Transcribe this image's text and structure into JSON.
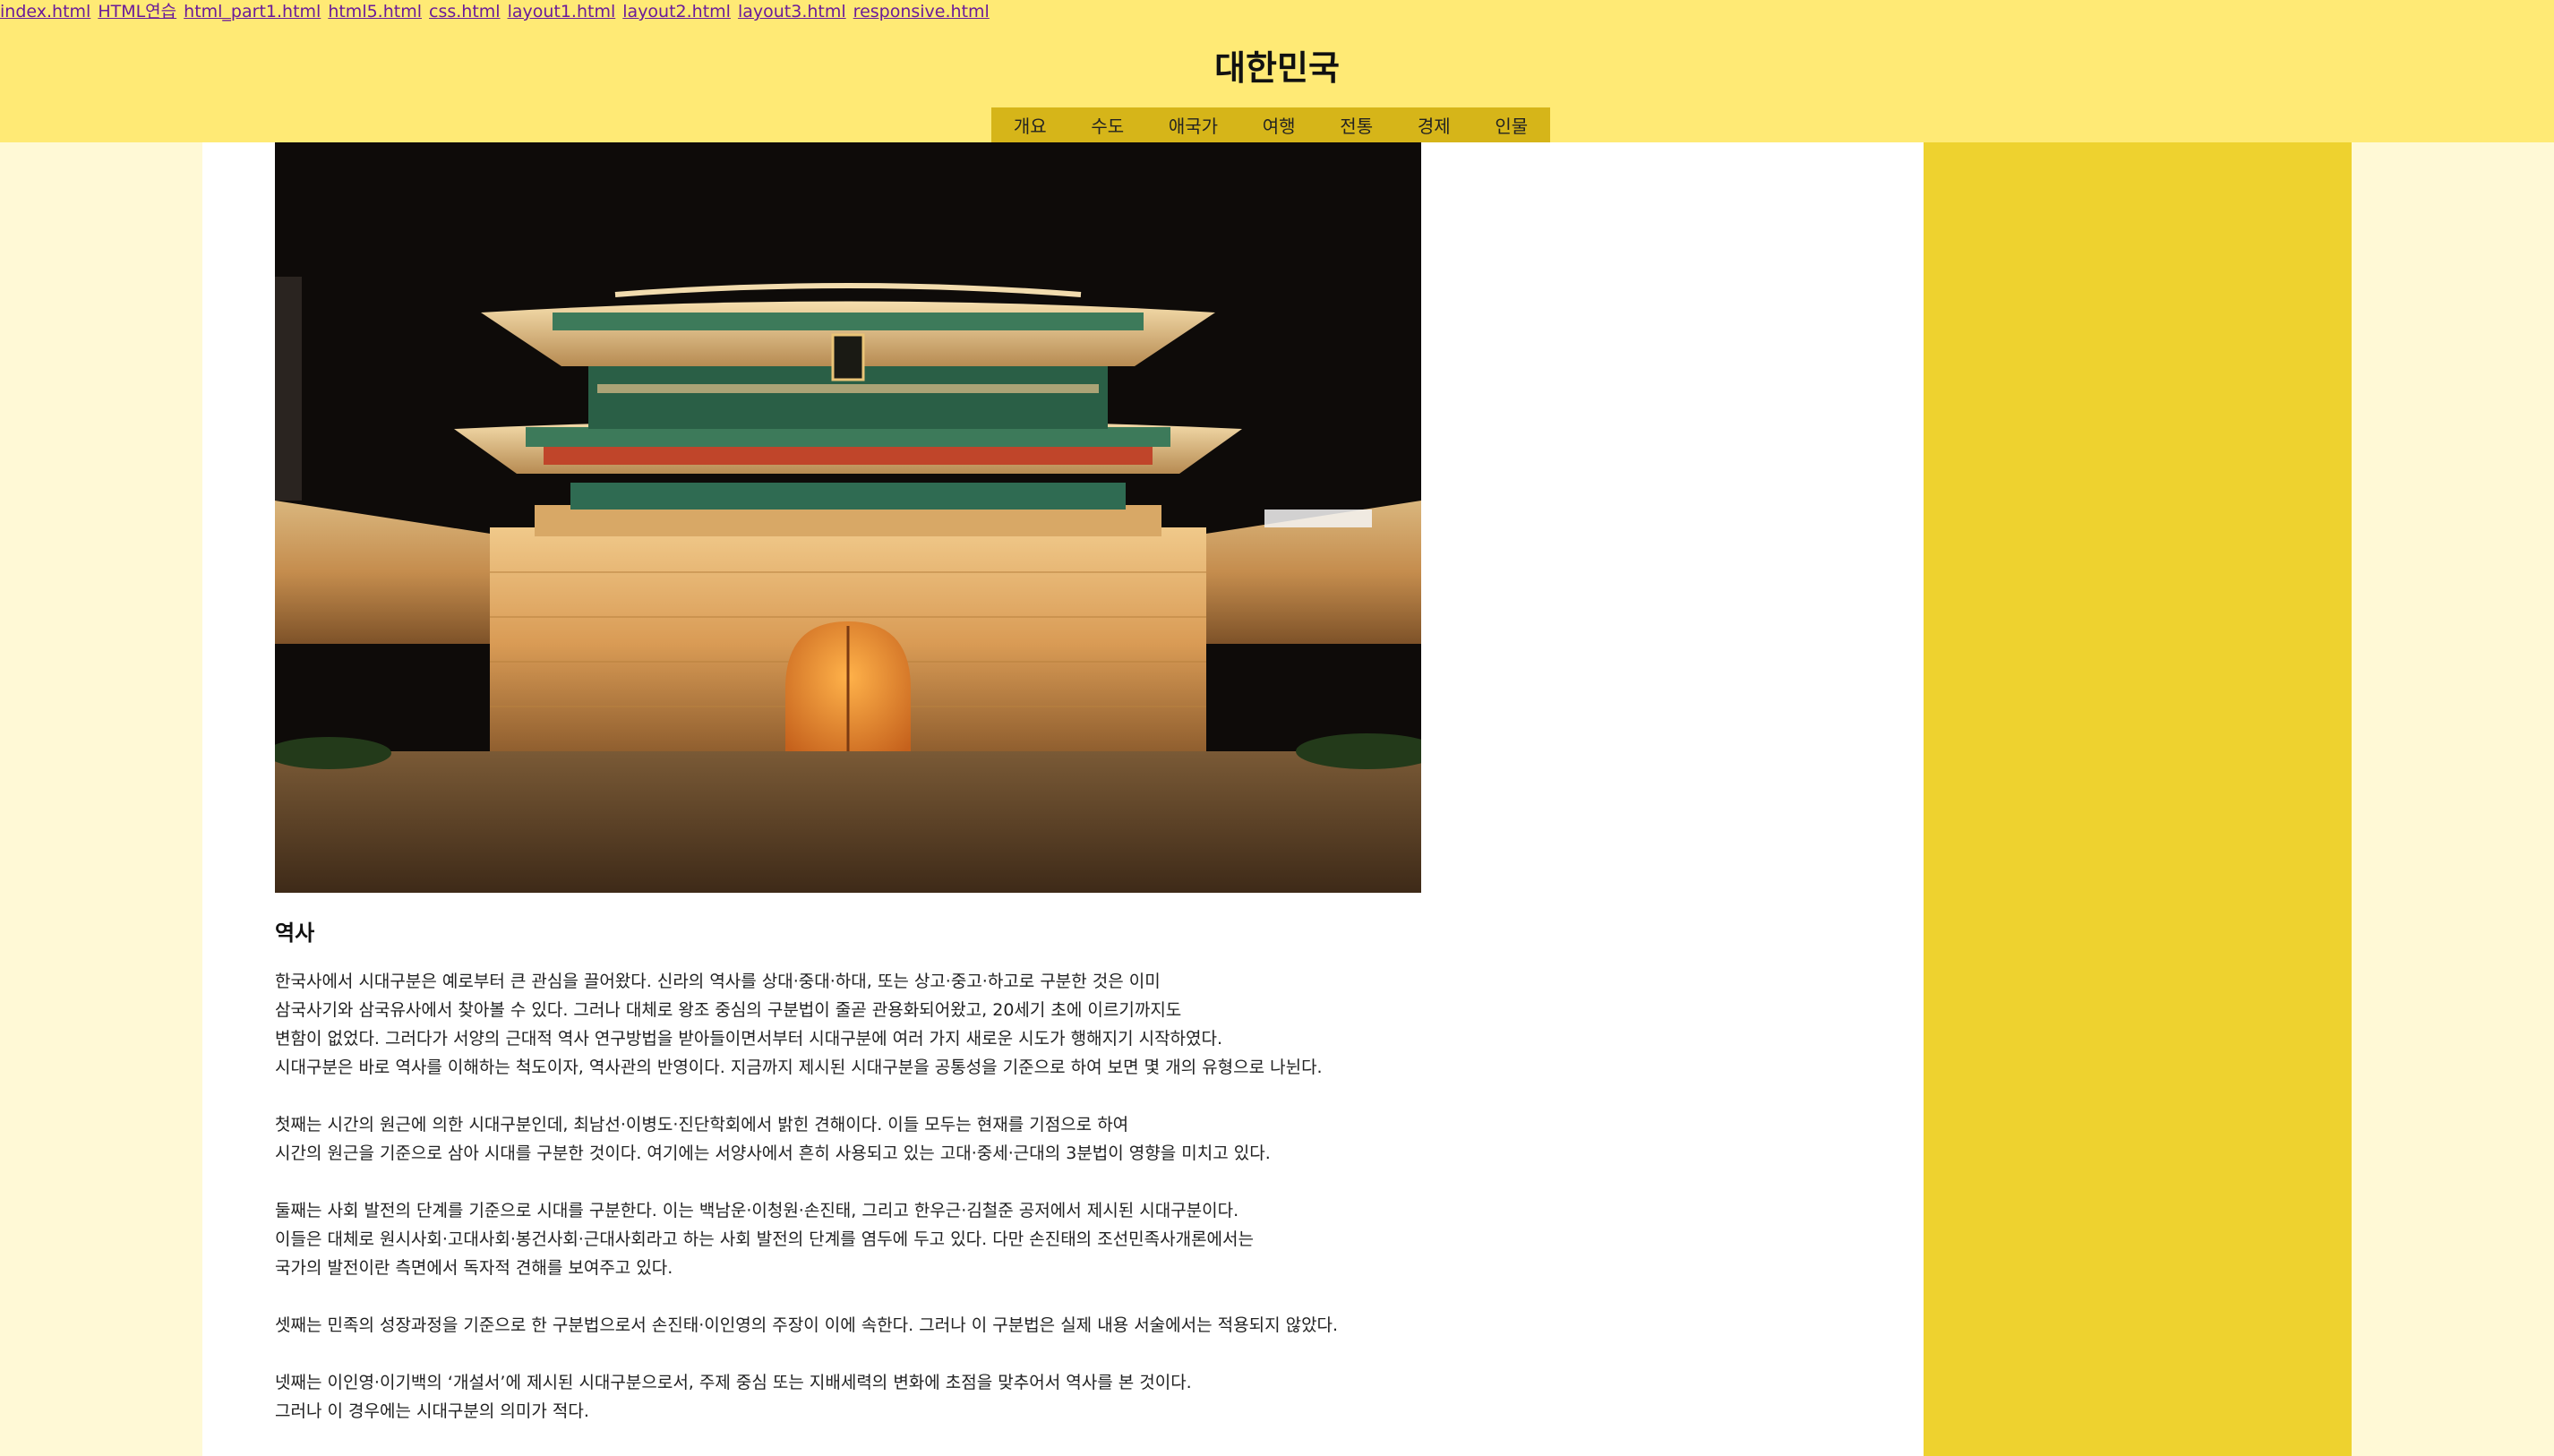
{
  "links": [
    "index.html",
    "HTML연습",
    "html_part1.html",
    "html5.html",
    "css.html",
    "layout1.html",
    "layout2.html",
    "layout3.html",
    "responsive.html"
  ],
  "header": {
    "title": "대한민국"
  },
  "nav": [
    "개요",
    "수도",
    "애국가",
    "여행",
    "전통",
    "경제",
    "인물"
  ],
  "main": {
    "section_title": "역사",
    "paragraphs": [
      [
        "한국사에서 시대구분은 예로부터 큰 관심을 끌어왔다. 신라의 역사를 상대·중대·하대, 또는 상고·중고·하고로 구분한 것은 이미",
        "삼국사기와 삼국유사에서 찾아볼 수 있다. 그러나 대체로 왕조 중심의 구분법이 줄곧 관용화되어왔고, 20세기 초에 이르기까지도",
        "변함이 없었다. 그러다가 서양의 근대적 역사 연구방법을 받아들이면서부터 시대구분에 여러 가지 새로운 시도가 행해지기 시작하였다.",
        "시대구분은 바로 역사를 이해하는 척도이자, 역사관의 반영이다. 지금까지 제시된 시대구분을 공통성을 기준으로 하여 보면 몇 개의 유형으로 나뉜다."
      ],
      [
        "첫째는 시간의 원근에 의한 시대구분인데, 최남선·이병도·진단학회에서 밝힌 견해이다. 이들 모두는 현재를 기점으로 하여",
        "시간의 원근을 기준으로 삼아 시대를 구분한 것이다. 여기에는 서양사에서 흔히 사용되고 있는 고대·중세·근대의 3분법이 영향을 미치고 있다."
      ],
      [
        "둘째는 사회 발전의 단계를 기준으로 시대를 구분한다. 이는 백남운·이청원·손진태, 그리고 한우근·김철준 공저에서 제시된 시대구분이다.",
        "이들은 대체로 원시사회·고대사회·봉건사회·근대사회라고 하는 사회 발전의 단계를 염두에 두고 있다. 다만 손진태의 조선민족사개론에서는",
        "국가의 발전이란 측면에서 독자적 견해를 보여주고 있다."
      ],
      [
        "셋째는 민족의 성장과정을 기준으로 한 구분법으로서 손진태·이인영의 주장이 이에 속한다. 그러나 이 구분법은 실제 내용 서술에서는 적용되지 않았다."
      ],
      [
        "넷째는 이인영·이기백의 ‘개설서’에 제시된 시대구분으로서, 주제 중심 또는 지배세력의 변화에 초점을 맞추어서 역사를 본 것이다.",
        "그러나 이 경우에는 시대구분의 의미가 적다."
      ]
    ]
  },
  "colors": {
    "header_bg": "#ffea75",
    "nav_bg": "#d6b519",
    "aside_bg": "#eed22f",
    "page_bg": "#fff9d6",
    "link": "#6a1b9a"
  },
  "icons": {
    "hero_image": "namdaemun-gate-night-photo"
  }
}
